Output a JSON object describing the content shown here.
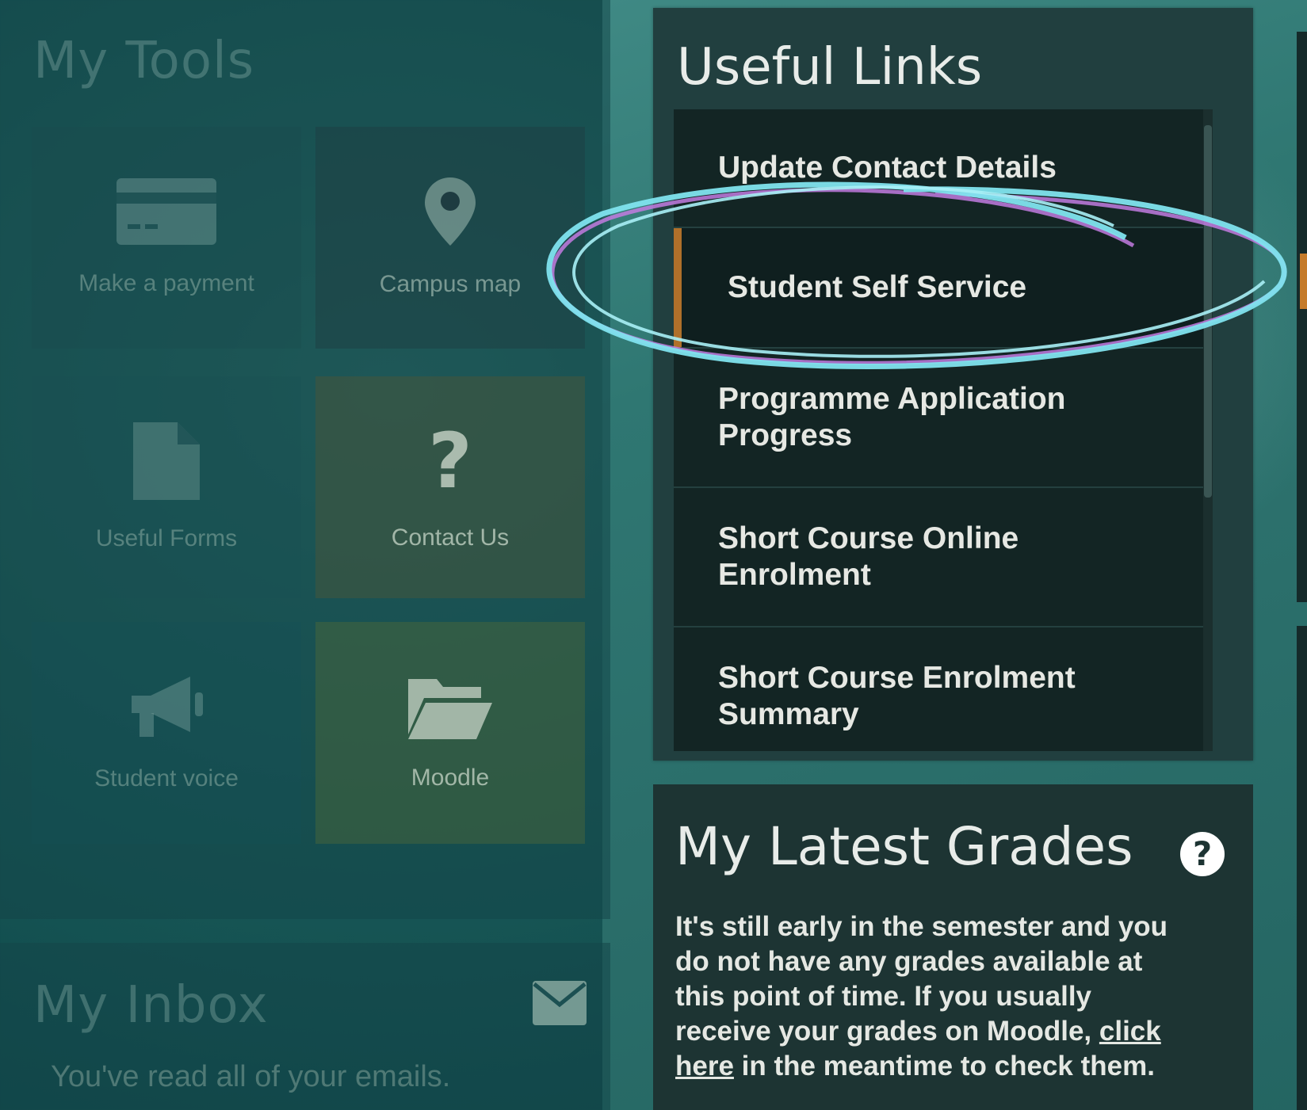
{
  "my_tools": {
    "heading": "My Tools",
    "tiles": [
      {
        "label": "Make a payment",
        "icon": "credit-card-icon"
      },
      {
        "label": "Campus map",
        "icon": "map-pin-icon"
      },
      {
        "label": "Useful Forms",
        "icon": "document-icon"
      },
      {
        "label": "Contact Us",
        "icon": "question-mark-icon"
      },
      {
        "label": "Student voice",
        "icon": "megaphone-icon"
      },
      {
        "label": "Moodle",
        "icon": "folder-open-icon"
      }
    ]
  },
  "useful_links": {
    "heading": "Useful Links",
    "items": [
      {
        "label": "Update Contact Details"
      },
      {
        "label": "Student Self Service",
        "active": true
      },
      {
        "label": "Programme Application Progress"
      },
      {
        "label": "Short Course Online Enrolment"
      },
      {
        "label": "Short Course Enrolment Summary"
      }
    ]
  },
  "latest_grades": {
    "heading": "My Latest Grades",
    "help_icon": "question-circle-icon",
    "text_before_link": "It's still early in the semester and you do not have any grades available at this point of time. If you usually receive your grades on Moodle,",
    "link_text": "click here",
    "text_after_link": "in the meantime to check them."
  },
  "inbox": {
    "heading": "My Inbox",
    "icon": "envelope-icon",
    "message": "You've read all of your emails."
  },
  "colors": {
    "active_accent": "#b0702a",
    "annotation_cyan": "#7fe3ee",
    "annotation_purple": "#c27be0"
  }
}
